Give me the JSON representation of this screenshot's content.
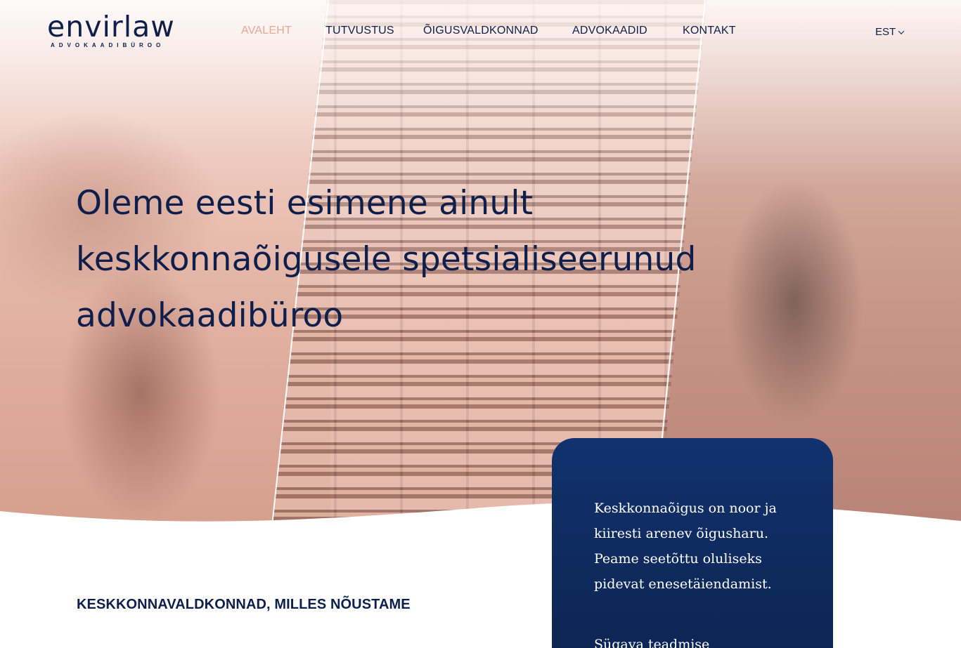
{
  "brand": {
    "name": "envirlaw",
    "tagline": "ADVOKAADIBÜROO"
  },
  "nav": {
    "items": [
      {
        "label": "AVALEHT",
        "active": true
      },
      {
        "label": "TUTVUSTUS",
        "active": false
      },
      {
        "label": "ÕIGUSVALDKONNAD",
        "active": false
      },
      {
        "label": "ADVOKAADID",
        "active": false
      },
      {
        "label": "KONTAKT",
        "active": false
      }
    ],
    "language": "EST"
  },
  "hero": {
    "title_lines": [
      "Oleme eesti esimene ainult",
      "keskkonnaõigusele spetsialiseerunud",
      "advokaadibüroo"
    ]
  },
  "section": {
    "heading": "KESKKONNAVALDKONNAD, MILLES NÕUSTAME"
  },
  "card": {
    "text": "Keskkonnaõigus on noor ja kiiresti arenev õigusharu. Peame seetõttu oluliseks pidevat enesetäiendamist.",
    "text_partial": "Sügava teadmise"
  },
  "colors": {
    "navy": "#0d1f4a",
    "accent": "#e4a896",
    "card": "#0f2b5f"
  }
}
